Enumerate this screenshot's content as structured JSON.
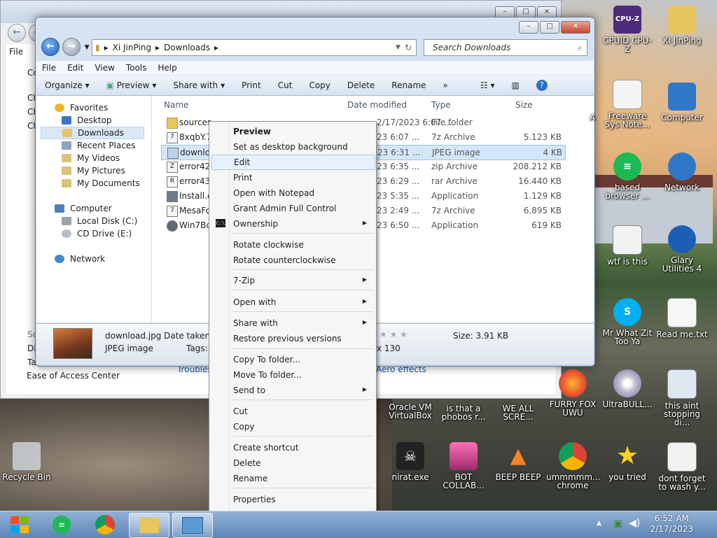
{
  "colors": {
    "accent": "#1f5ec5",
    "selection": "#d4e6fa",
    "menu_bg": "#f6f6f6"
  },
  "bg_window": {
    "menu_file": "File",
    "labels": [
      "Co",
      "Ch",
      "Ch",
      "Ch",
      "Se",
      "Di",
      "Ta"
    ],
    "ease_link": "Ease of Access Center",
    "troubleshoot": "Troubles",
    "aero": "Aero effects"
  },
  "explorer": {
    "breadcrumb": [
      "Xi JinPing",
      "Downloads"
    ],
    "search_placeholder": "Search Downloads",
    "menu": [
      "File",
      "Edit",
      "View",
      "Tools",
      "Help"
    ],
    "toolbar": {
      "organize": "Organize",
      "preview": "Preview",
      "share": "Share with",
      "print": "Print",
      "cut": "Cut",
      "copy": "Copy",
      "delete": "Delete",
      "rename": "Rename",
      "more": "»"
    },
    "nav": {
      "favorites": "Favorites",
      "desktop": "Desktop",
      "downloads": "Downloads",
      "recent": "Recent Places",
      "videos": "My Videos",
      "pictures": "My Pictures",
      "documents": "My Documents",
      "computer": "Computer",
      "local_disk": "Local Disk (C:)",
      "cd_drive": "CD Drive (E:)",
      "network": "Network"
    },
    "columns": {
      "name": "Name",
      "date": "Date modified",
      "type": "Type",
      "size": "Size"
    },
    "files": [
      {
        "name": "sources",
        "date": "2/17/2023 6:07 ...",
        "type": "File folder",
        "size": ""
      },
      {
        "name": "8xqbY.7",
        "date": "23 6:07 ...",
        "type": "7z Archive",
        "size": "5.123 KB"
      },
      {
        "name": "downloa",
        "date": "23 6:31 ...",
        "type": "JPEG image",
        "size": "4 KB"
      },
      {
        "name": "error42",
        "date": "23 6:35 ...",
        "type": "zip Archive",
        "size": "208.212 KB"
      },
      {
        "name": "error43",
        "date": "23 6:29 ...",
        "type": "rar Archive",
        "size": "16.440 KB"
      },
      {
        "name": "Install.ex",
        "date": "23 5:35 ...",
        "type": "Application",
        "size": "1.129 KB"
      },
      {
        "name": "MesaFo",
        "date": "23 2:49 ...",
        "type": "7z Archive",
        "size": "6.895 KB"
      },
      {
        "name": "Win7Bo",
        "date": "23 6:50 ...",
        "type": "Application",
        "size": "619 KB"
      }
    ],
    "details": {
      "filename": "download.jpg",
      "date_label": "Date taken:",
      "filetype": "JPEG image",
      "tags_label": "Tags:",
      "size": "Size: 3.91 KB",
      "dims": "x 130",
      "stars": "★ ★ ★"
    }
  },
  "context_menu": {
    "preview": "Preview",
    "set_bg": "Set as desktop background",
    "edit": "Edit",
    "print": "Print",
    "notepad": "Open with Notepad",
    "grant": "Grant Admin Full Control",
    "ownership": "Ownership",
    "rot_cw": "Rotate clockwise",
    "rot_ccw": "Rotate counterclockwise",
    "zip": "7-Zip",
    "open_with": "Open with",
    "share_with": "Share with",
    "restore": "Restore previous versions",
    "copy_to": "Copy To folder...",
    "move_to": "Move To folder...",
    "send_to": "Send to",
    "cut": "Cut",
    "copy": "Copy",
    "shortcut": "Create shortcut",
    "delete": "Delete",
    "rename": "Rename",
    "properties": "Properties",
    "cmd_icon": "C:\\"
  },
  "desktop": {
    "cpuz": "CPUID CPU-Z",
    "user": "Xi JinPing",
    "freeware": "Freeware Sys Note...",
    "computer": "Computer",
    "based": "based browser ...",
    "network": "Network",
    "wtf": "wtf is this",
    "glary": "Glary Utilities 4",
    "mr": "Mr What Zit Too Ya",
    "readme": "Read me.txt",
    "oracle": "Oracle VM VirtualBox",
    "phobos": "is that a phobos r...",
    "weall": "WE ALL SCRE...",
    "furry": "FURRY FOX UWU",
    "ultrabull": "UltraBULL...",
    "aint": "this aint stopping di...",
    "recycle": "Recycle Bin",
    "nirat": "nirat.exe",
    "bot": "BOT COLLAB...",
    "beep": "BEEP BEEP",
    "chrome": "ummmmm... chrome",
    "youtried": "you tried",
    "dontforget": "dont forget to wash y...",
    "partial_a": "A",
    "cpuz_badge": "CPU-Z"
  },
  "taskbar": {
    "time": "6:52 AM",
    "date": "2/17/2023"
  }
}
